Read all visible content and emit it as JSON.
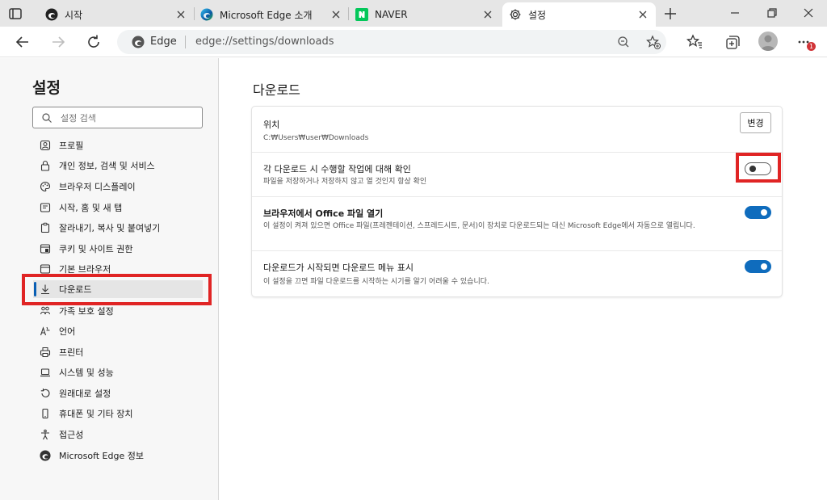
{
  "tabs": [
    {
      "title": "시작",
      "favicon": "edge-start-icon"
    },
    {
      "title": "Microsoft Edge 소개",
      "favicon": "edge-icon"
    },
    {
      "title": "NAVER",
      "favicon": "naver-icon"
    },
    {
      "title": "설정",
      "favicon": "gear-icon"
    }
  ],
  "address": {
    "brand": "Edge",
    "url": "edge://settings/downloads"
  },
  "profile": {
    "notification_badge": "1"
  },
  "sidebar": {
    "title": "설정",
    "search_placeholder": "설정 검색",
    "items": [
      {
        "label": "프로필",
        "icon": "profile-icon"
      },
      {
        "label": "개인 정보, 검색 및 서비스",
        "icon": "lock-icon"
      },
      {
        "label": "브라우저 디스플레이",
        "icon": "appearance-icon"
      },
      {
        "label": "시작, 홈 및 새 탭",
        "icon": "power-icon"
      },
      {
        "label": "잘라내기, 복사 및 붙여넣기",
        "icon": "clipboard-icon"
      },
      {
        "label": "쿠키 및 사이트 권한",
        "icon": "site-permissions-icon"
      },
      {
        "label": "기본 브라우저",
        "icon": "browser-icon"
      },
      {
        "label": "다운로드",
        "icon": "download-icon"
      },
      {
        "label": "가족 보호 설정",
        "icon": "family-icon"
      },
      {
        "label": "언어",
        "icon": "language-icon"
      },
      {
        "label": "프린터",
        "icon": "printer-icon"
      },
      {
        "label": "시스템 및 성능",
        "icon": "laptop-icon"
      },
      {
        "label": "원래대로 설정",
        "icon": "reset-icon"
      },
      {
        "label": "휴대폰 및 기타 장치",
        "icon": "phone-icon"
      },
      {
        "label": "접근성",
        "icon": "accessibility-icon"
      },
      {
        "label": "Microsoft Edge 정보",
        "icon": "edge-icon"
      }
    ],
    "active_index": 7
  },
  "main": {
    "title": "다운로드",
    "location": {
      "title": "위치",
      "path": "C:₩Users₩user₩Downloads",
      "button": "변경"
    },
    "settings": [
      {
        "title": "각 다운로드 시 수행할 작업에 대해 확인",
        "desc": "파일을 저장하거나 저장하지 않고 열 것인지 항상 확인",
        "enabled": false
      },
      {
        "title": "브라우저에서 Office 파일 열기",
        "desc": "이 설정이 켜져 있으면 Office 파일(프레젠테이션, 스프레드시트, 문서)이 장치로 다운로드되는 대신 Microsoft Edge에서 자동으로 열립니다.",
        "enabled": true
      },
      {
        "title": "다운로드가 시작되면 다운로드 메뉴 표시",
        "desc": "이 설정을 끄면 파일 다운로드를 시작하는 시기를 알기 어려울 수 있습니다.",
        "enabled": true
      }
    ]
  },
  "colors": {
    "accent": "#0f6cbd",
    "highlight": "#e02424"
  }
}
